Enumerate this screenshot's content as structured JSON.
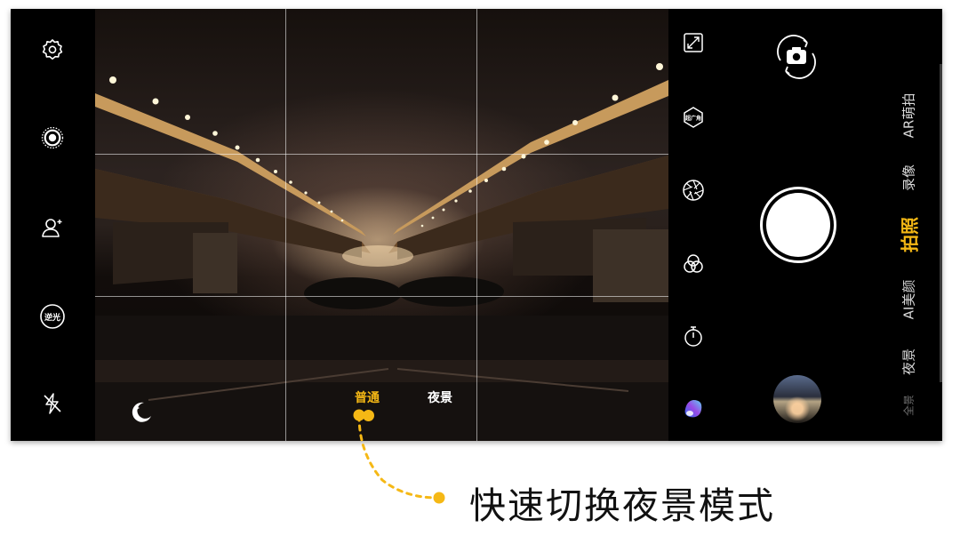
{
  "left_toolbar": {
    "backlight_label": "逆光"
  },
  "viewfinder": {
    "mode_switch": {
      "normal_label": "普通",
      "night_label": "夜景",
      "active_color": "#f5b815"
    }
  },
  "right_controls": {
    "ultra_wide_label": "超广角"
  },
  "mode_list": {
    "items": [
      {
        "label": "AR萌拍",
        "state": "normal"
      },
      {
        "label": "录像",
        "state": "normal"
      },
      {
        "label": "拍照",
        "state": "active"
      },
      {
        "label": "AI美颜",
        "state": "normal"
      },
      {
        "label": "夜景",
        "state": "normal"
      },
      {
        "label": "全景",
        "state": "faded"
      }
    ],
    "active_color": "#f5b815"
  },
  "annotation": {
    "text": "快速切换夜景模式",
    "accent_color": "#f5b815"
  },
  "icons": [
    "settings-icon",
    "live-photo-icon",
    "portrait-icon",
    "backlight-icon",
    "flash-off-icon",
    "night-moon-icon",
    "expand-icon",
    "ultra-wide-icon",
    "aperture-icon",
    "filter-icon",
    "timer-icon",
    "color-effect-icon",
    "switch-camera-icon"
  ]
}
